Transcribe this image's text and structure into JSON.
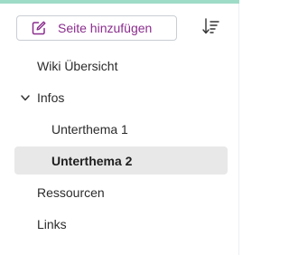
{
  "toolbar": {
    "add_page_label": "Seite hinzufügen",
    "add_page_icon": "edit-square-icon",
    "sort_icon": "sort-descending-icon",
    "accent_color": "#8a2d8d"
  },
  "nav": {
    "items": [
      {
        "label": "Wiki Übersicht",
        "level": 1,
        "selected": false
      },
      {
        "label": "Infos",
        "level": 1,
        "expanded": true,
        "icon": "chevron-down-icon"
      },
      {
        "label": "Unterthema 1",
        "level": 2,
        "selected": false
      },
      {
        "label": "Unterthema 2",
        "level": 2,
        "selected": true
      },
      {
        "label": "Ressourcen",
        "level": 1,
        "selected": false
      },
      {
        "label": "Links",
        "level": 1,
        "selected": false
      }
    ]
  },
  "colors": {
    "top_accent": "#9fdcc7",
    "selected_background": "#e8e8e8"
  }
}
